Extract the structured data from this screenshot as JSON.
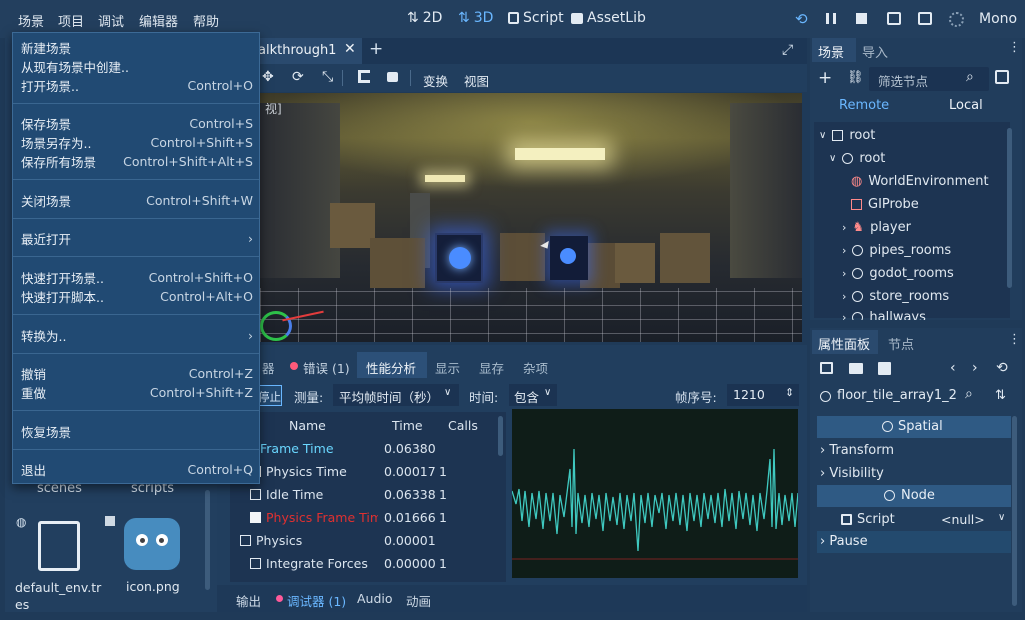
{
  "menubar": {
    "items": [
      "场景",
      "项目",
      "调试",
      "编辑器",
      "帮助"
    ]
  },
  "modes": {
    "2d": "2D",
    "3d": "3D",
    "script": "Script",
    "assetlib": "AssetLib"
  },
  "top_right": {
    "mono": "Mono"
  },
  "scene_menu": {
    "items": [
      {
        "label": "新建场景",
        "shortcut": ""
      },
      {
        "label": "从现有场景中创建..",
        "shortcut": ""
      },
      {
        "label": "打开场景..",
        "shortcut": "Control+O"
      },
      {
        "label": "保存场景",
        "shortcut": "Control+S"
      },
      {
        "label": "场景另存为..",
        "shortcut": "Control+Shift+S"
      },
      {
        "label": "保存所有场景",
        "shortcut": "Control+Shift+Alt+S"
      },
      {
        "label": "关闭场景",
        "shortcut": "Control+Shift+W"
      },
      {
        "label": "最近打开",
        "shortcut": ""
      },
      {
        "label": "快速打开场景..",
        "shortcut": "Control+Shift+O"
      },
      {
        "label": "快速打开脚本..",
        "shortcut": "Control+Alt+O"
      },
      {
        "label": "转换为..",
        "shortcut": ""
      },
      {
        "label": "撤销",
        "shortcut": "Control+Z"
      },
      {
        "label": "重做",
        "shortcut": "Control+Shift+Z"
      },
      {
        "label": "恢复场景",
        "shortcut": ""
      },
      {
        "label": "退出",
        "shortcut": "Control+Q"
      }
    ]
  },
  "editor_tab": {
    "title": "alkthrough1"
  },
  "viewport_toolbar": {
    "transform": "变换",
    "view": "视图"
  },
  "viewport": {
    "label_fragment": "视]"
  },
  "filesystem": {
    "folders": [
      "scenes",
      "scripts"
    ],
    "files": [
      "default_env.tres",
      "icon.png"
    ]
  },
  "scene_dock": {
    "tabs": [
      "场景",
      "导入"
    ],
    "filter_placeholder": "筛选节点",
    "remote": "Remote",
    "local": "Local",
    "nodes": [
      "root",
      "root",
      "WorldEnvironment",
      "GIProbe",
      "player",
      "pipes_rooms",
      "godot_rooms",
      "store_rooms",
      "hallways"
    ]
  },
  "debugger": {
    "tabs": [
      "器",
      "错误 (1)",
      "性能分析",
      "显示",
      "显存",
      "杂项"
    ],
    "stop": "停止",
    "measure_label": "测量:",
    "measure_value": "平均帧时间（秒）",
    "time_label": "时间:",
    "time_value": "包含",
    "frame_label": "帧序号:",
    "frame_value": "1210",
    "columns": [
      "Name",
      "Time",
      "Calls"
    ],
    "rows": [
      {
        "name": "Frame Time",
        "time": "0.06380",
        "calls": ""
      },
      {
        "name": "Physics Time",
        "time": "0.00017",
        "calls": "1"
      },
      {
        "name": "Idle Time",
        "time": "0.06338",
        "calls": "1"
      },
      {
        "name": "Physics Frame Tim",
        "time": "0.01666",
        "calls": "1"
      },
      {
        "name": "Physics",
        "time": "0.00001",
        "calls": ""
      },
      {
        "name": "Integrate Forces",
        "time": "0.00000",
        "calls": "1"
      }
    ]
  },
  "bottom_tabs": {
    "output": "输出",
    "debugger": "调试器 (1)",
    "audio": "Audio",
    "animation": "动画"
  },
  "inspector": {
    "tabs": [
      "属性面板",
      "节点"
    ],
    "object_name": "floor_tile_array1_2",
    "sections": {
      "spatial": "Spatial",
      "transform": "Transform",
      "visibility": "Visibility",
      "node": "Node",
      "script": "Script",
      "script_value": "<null>",
      "pause": "Pause"
    }
  }
}
